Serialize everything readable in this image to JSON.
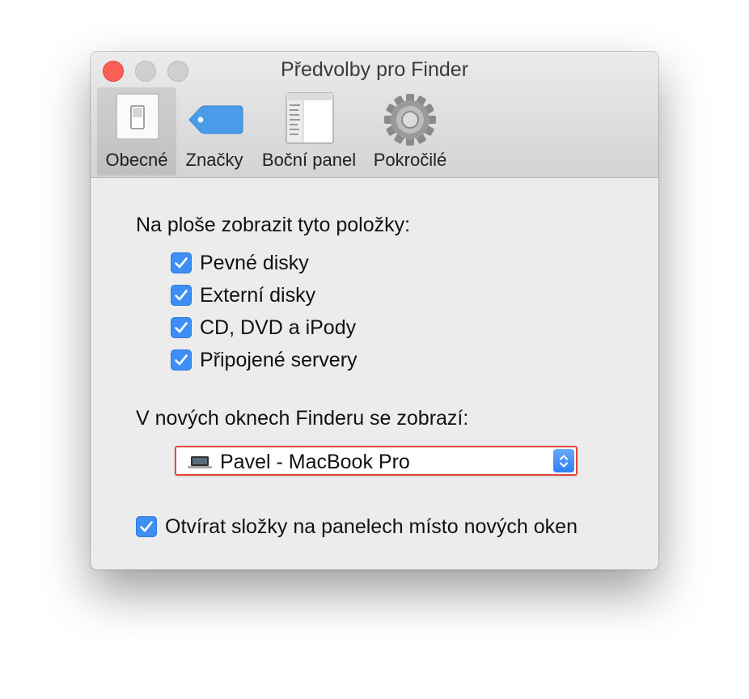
{
  "window": {
    "title": "Předvolby pro Finder"
  },
  "toolbar": {
    "tabs": [
      {
        "label": "Obecné",
        "icon": "switch-icon",
        "selected": true
      },
      {
        "label": "Značky",
        "icon": "tag-icon",
        "selected": false
      },
      {
        "label": "Boční panel",
        "icon": "sidebar-icon",
        "selected": false
      },
      {
        "label": "Pokročilé",
        "icon": "gear-icon",
        "selected": false
      }
    ]
  },
  "desktop_items": {
    "heading": "Na ploše zobrazit tyto položky:",
    "options": [
      {
        "label": "Pevné disky",
        "checked": true
      },
      {
        "label": "Externí disky",
        "checked": true
      },
      {
        "label": "CD, DVD a iPody",
        "checked": true
      },
      {
        "label": "Připojené servery",
        "checked": true
      }
    ]
  },
  "new_window": {
    "heading": "V nových oknech Finderu se zobrazí:",
    "selected": "Pavel - MacBook Pro",
    "icon": "laptop-icon"
  },
  "tabs_option": {
    "label": "Otvírat složky na panelech místo nových oken",
    "checked": true
  },
  "colors": {
    "accent": "#3d8ef5",
    "close": "#fc5f57",
    "highlight_border": "#e0483a"
  }
}
